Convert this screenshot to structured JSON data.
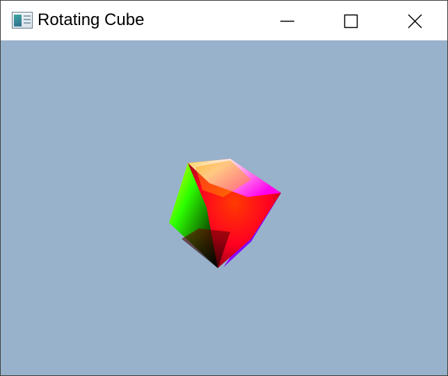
{
  "window": {
    "title": "Rotating Cube",
    "app_icon": "app-window-icon",
    "controls": {
      "minimize_icon": "minimize-icon",
      "maximize_icon": "maximize-icon",
      "close_icon": "close-icon"
    }
  },
  "scene": {
    "background_color": "#98b2cc",
    "object": "rgb-color-cube",
    "vertex_colors": {
      "top": "#ffff00",
      "top_right": "#ffffff",
      "right": "#ff00ff",
      "left": "#00ff00",
      "center": "#ff0000",
      "bottom": "#000000",
      "edge": "#0000ff"
    }
  }
}
